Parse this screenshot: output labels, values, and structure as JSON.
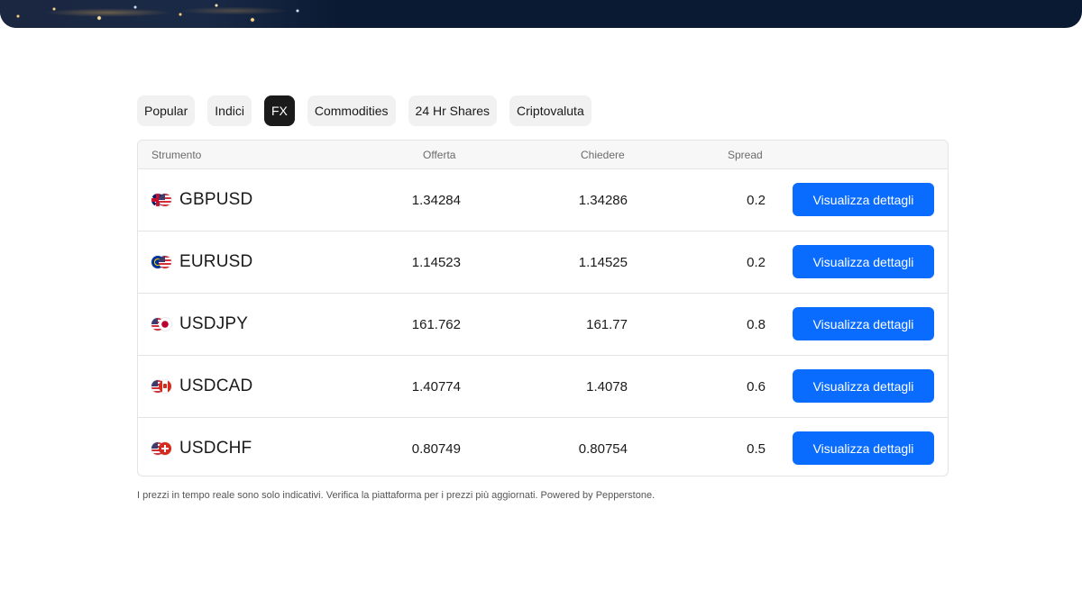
{
  "tabs": [
    {
      "label": "Popular",
      "active": false
    },
    {
      "label": "Indici",
      "active": false
    },
    {
      "label": "FX",
      "active": true
    },
    {
      "label": "Commodities",
      "active": false
    },
    {
      "label": "24 Hr Shares",
      "active": false
    },
    {
      "label": "Criptovaluta",
      "active": false
    }
  ],
  "table": {
    "headers": {
      "instrument": "Strumento",
      "bid": "Offerta",
      "ask": "Chiedere",
      "spread": "Spread"
    },
    "rows": [
      {
        "symbol": "GBPUSD",
        "bid": "1.34284",
        "ask": "1.34286",
        "spread": "0.2",
        "button": "Visualizza dettagli",
        "flags": [
          "gb-flag-icon",
          "us-flag-icon"
        ]
      },
      {
        "symbol": "EURUSD",
        "bid": "1.14523",
        "ask": "1.14525",
        "spread": "0.2",
        "button": "Visualizza dettagli",
        "flags": [
          "eu-flag-icon",
          "us-flag-icon"
        ]
      },
      {
        "symbol": "USDJPY",
        "bid": "161.762",
        "ask": "161.77",
        "spread": "0.8",
        "button": "Visualizza dettagli",
        "flags": [
          "us-flag-icon",
          "jp-flag-icon"
        ]
      },
      {
        "symbol": "USDCAD",
        "bid": "1.40774",
        "ask": "1.4078",
        "spread": "0.6",
        "button": "Visualizza dettagli",
        "flags": [
          "us-flag-icon",
          "ca-flag-icon"
        ]
      },
      {
        "symbol": "USDCHF",
        "bid": "0.80749",
        "ask": "0.80754",
        "spread": "0.5",
        "button": "Visualizza dettagli",
        "flags": [
          "us-flag-icon",
          "ch-flag-icon"
        ]
      }
    ]
  },
  "disclaimer": "I prezzi in tempo reale sono solo indicativi. Verifica la piattaforma per i prezzi più aggiornati. Powered by Pepperstone.",
  "colors": {
    "accent": "#0a6cff",
    "active_tab": "#1a1a1a",
    "hero": "#0b1a33"
  }
}
